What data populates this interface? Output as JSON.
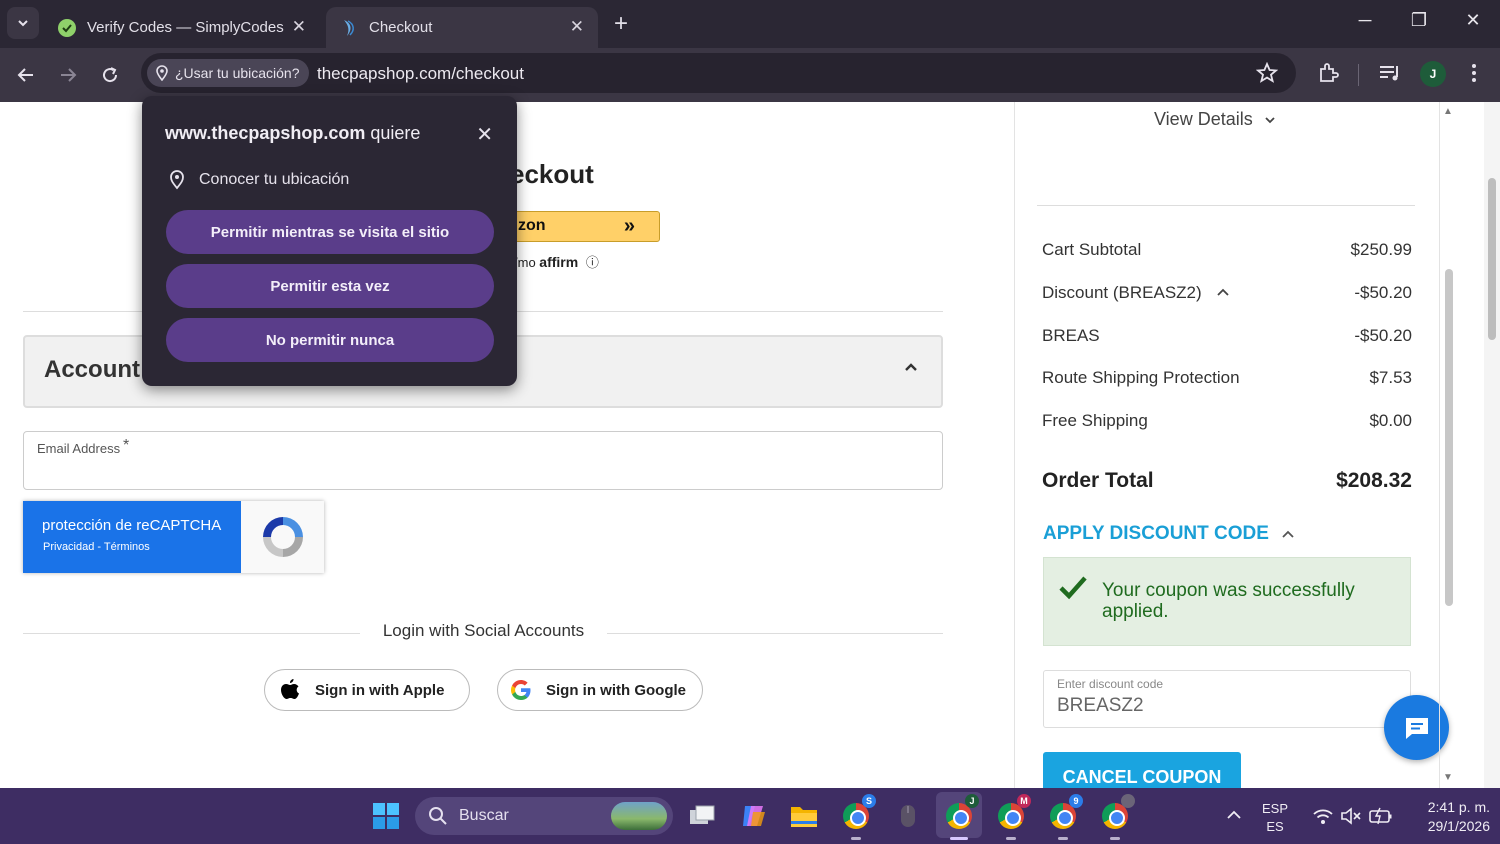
{
  "browser": {
    "tabs": [
      {
        "title": "Verify Codes — SimplyCodes",
        "active": false
      },
      {
        "title": "Checkout",
        "active": true
      }
    ],
    "location_chip": "¿Usar tu ubicación?",
    "url": "thecpapshop.com/checkout",
    "profile_initial": "J"
  },
  "permission_popup": {
    "site": "www.thecpapshop.com",
    "wants": "quiere",
    "request": "Conocer tu ubicación",
    "buttons": [
      "Permitir mientras se visita el sitio",
      "Permitir esta vez",
      "No permitir nunca"
    ]
  },
  "checkout": {
    "title_fragment": "eckout",
    "amazon_fragment": "zon",
    "affirm_fragment": "/mo",
    "affirm_brand": "affirm",
    "account_title": "Account I",
    "email_label": "Email Address",
    "email_required": "*",
    "recaptcha_title": "protección de reCAPTCHA",
    "recaptcha_links": "Privacidad - Términos",
    "social_title": "Login with Social Accounts",
    "apple_btn": "Sign in with Apple",
    "google_btn": "Sign in with Google"
  },
  "summary": {
    "view_details": "View Details",
    "rows": [
      {
        "label": "Cart Subtotal",
        "value": "$250.99"
      },
      {
        "label": "Discount (BREASZ2)",
        "value": "-$50.20"
      },
      {
        "label": "BREAS",
        "value": "-$50.20"
      },
      {
        "label": "Route Shipping Protection",
        "value": "$7.53"
      },
      {
        "label": "Free Shipping",
        "value": "$0.00"
      }
    ],
    "order_total_label": "Order Total",
    "order_total_value": "$208.32",
    "apply_discount": "APPLY DISCOUNT CODE",
    "success_message": "Your coupon was successfully applied.",
    "discount_placeholder": "Enter discount code",
    "discount_value": "BREASZ2",
    "cancel_coupon": "CANCEL COUPON"
  },
  "taskbar": {
    "search_placeholder": "Buscar",
    "lang_top": "ESP",
    "lang_bottom": "ES",
    "time": "2:41 p. m.",
    "date": "29/1/2026",
    "chrome_badges": [
      "S",
      "J",
      "M",
      "9",
      ""
    ]
  },
  "colors": {
    "accent_purple": "#5a3d8a",
    "link_blue": "#1a9fd6",
    "success_green": "#1f6b1f",
    "taskbar": "#3e2d63"
  }
}
